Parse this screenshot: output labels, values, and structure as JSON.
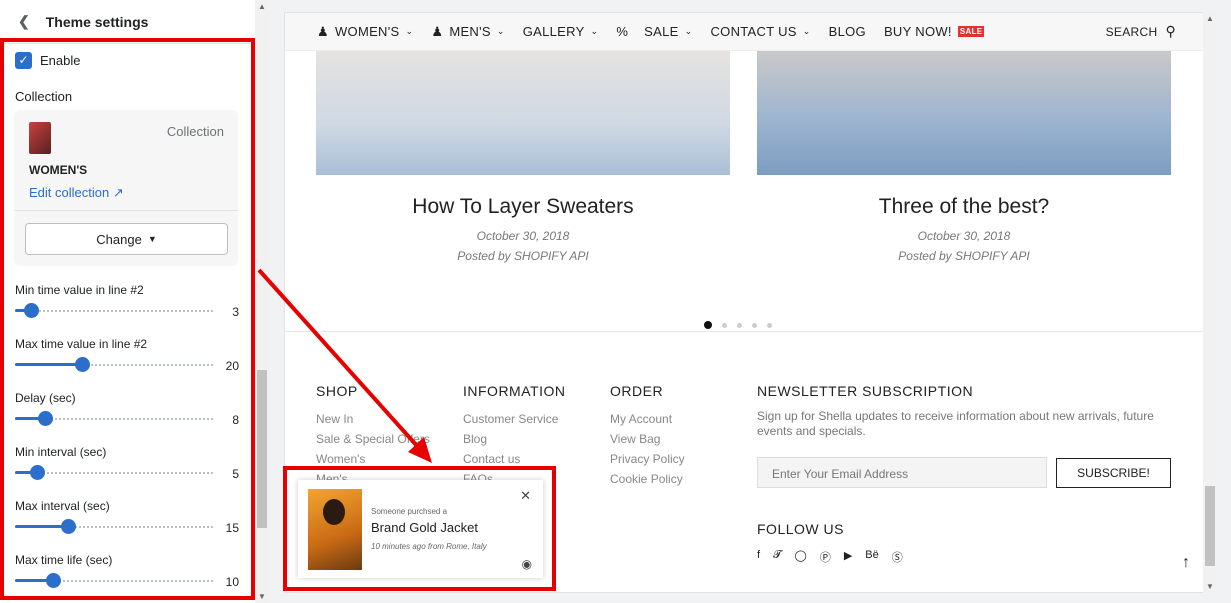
{
  "sidebar": {
    "title": "Theme settings",
    "enable_label": "Enable",
    "collection_label": "Collection",
    "collection_type": "Collection",
    "collection_name": "WOMEN'S",
    "edit_link": "Edit collection",
    "change_button": "Change",
    "sliders": [
      {
        "label": "Min time value in line #2",
        "value": "3",
        "fraction": 0.08
      },
      {
        "label": "Max time value in line #2",
        "value": "20",
        "fraction": 0.34
      },
      {
        "label": "Delay (sec)",
        "value": "8",
        "fraction": 0.15
      },
      {
        "label": "Min interval (sec)",
        "value": "5",
        "fraction": 0.11
      },
      {
        "label": "Max interval (sec)",
        "value": "15",
        "fraction": 0.27
      },
      {
        "label": "Max time life (sec)",
        "value": "10",
        "fraction": 0.19
      }
    ]
  },
  "nav": {
    "items": [
      "WOMEN'S",
      "MEN'S",
      "GALLERY",
      "SALE",
      "CONTACT US",
      "BLOG",
      "BUY NOW!"
    ],
    "badge": "SALE",
    "search": "SEARCH"
  },
  "posts": [
    {
      "title": "How To Layer Sweaters",
      "date": "October 30, 2018",
      "author": "Posted by SHOPIFY API"
    },
    {
      "title": "Three of the best?",
      "date": "October 30, 2018",
      "author": "Posted by SHOPIFY API"
    }
  ],
  "footer": {
    "shop": {
      "heading": "SHOP",
      "links": [
        "New In",
        "Sale & Special Offers",
        "Women's",
        "Men's"
      ]
    },
    "information": {
      "heading": "INFORMATION",
      "links": [
        "Customer Service",
        "Blog",
        "Contact us",
        "FAQs"
      ]
    },
    "order": {
      "heading": "ORDER",
      "links": [
        "My Account",
        "View Bag",
        "Privacy Policy",
        "Cookie Policy"
      ]
    },
    "newsletter": {
      "heading": "NEWSLETTER SUBSCRIPTION",
      "text": "Sign up for Shella updates to receive information about new arrivals, future events and specials.",
      "placeholder": "Enter Your Email Address",
      "button": "SUBSCRIBE!"
    },
    "follow": "FOLLOW US"
  },
  "popup": {
    "line1": "Someone purchsed a",
    "product": "Brand Gold Jacket",
    "meta": "10 minutes ago from Rome, Italy"
  },
  "colors": {
    "accent": "#2c6ecb",
    "highlight": "#e60000"
  }
}
